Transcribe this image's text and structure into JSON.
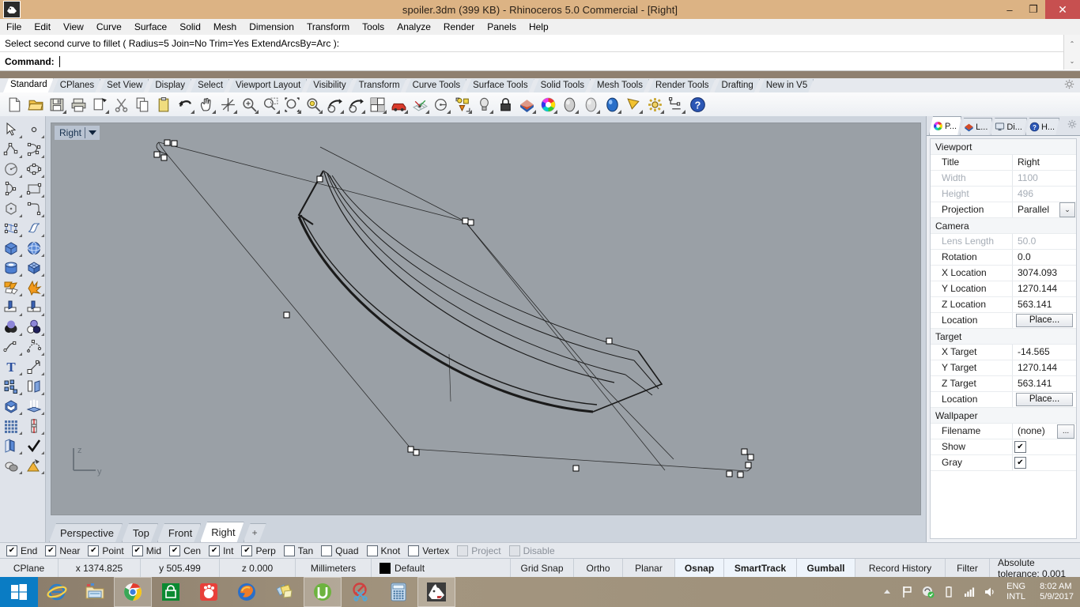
{
  "titlebar": {
    "app_icon": "rhino-icon",
    "title": "spoiler.3dm (399 KB) - Rhinoceros 5.0 Commercial - [Right]",
    "minimize": "–",
    "restore": "❐",
    "close": "✕"
  },
  "menubar": {
    "items": [
      "File",
      "Edit",
      "View",
      "Curve",
      "Surface",
      "Solid",
      "Mesh",
      "Dimension",
      "Transform",
      "Tools",
      "Analyze",
      "Render",
      "Panels",
      "Help"
    ]
  },
  "command": {
    "history": "Select second curve to fillet ( Radius=5  Join=No  Trim=Yes  ExtendArcsBy=Arc ):",
    "prompt_label": "Command:",
    "input_value": "",
    "scroll_up": "⌃",
    "scroll_down": "⌄"
  },
  "toolbar_tabs": {
    "items": [
      "Standard",
      "CPlanes",
      "Set View",
      "Display",
      "Select",
      "Viewport Layout",
      "Visibility",
      "Transform",
      "Curve Tools",
      "Surface Tools",
      "Solid Tools",
      "Mesh Tools",
      "Render Tools",
      "Drafting",
      "New in V5"
    ],
    "active": "Standard",
    "options_icon": "gear-icon"
  },
  "main_toolbar": {
    "icons": [
      "new-file-icon",
      "open-folder-icon",
      "save-icon",
      "print-icon",
      "copy-to-clipboard-icon",
      "cut-icon",
      "copy-icon",
      "paste-icon",
      "undo-icon",
      "pan-icon",
      "move-icon",
      "zoom-in-icon",
      "zoom-dynamic-icon",
      "zoom-window-icon",
      "zoom-extents-icon",
      "zoom-selected-icon",
      "rotate-view-icon",
      "four-viewport-icon",
      "render-icon",
      "grid-snap-icon",
      "circle-center-icon",
      "object-properties-icon",
      "light-icon",
      "lock-icon",
      "layer-icon",
      "color-wheel-icon",
      "shaded-sphere-icon",
      "ghosted-sphere-icon",
      "rendered-sphere-icon",
      "clipping-plane-icon",
      "options-gear-icon",
      "dimension-icon",
      "help-icon"
    ]
  },
  "left_palette": {
    "icons": [
      [
        "select-arrow-icon",
        "point-icon"
      ],
      [
        "polyline-icon",
        "curve-control-points-icon"
      ],
      [
        "circle-icon",
        "ellipse-icon"
      ],
      [
        "arc-icon",
        "rectangle-icon"
      ],
      [
        "polygon-icon",
        "curve-fillet-icon"
      ],
      [
        "surface-control-points-icon",
        "surface-sweep-icon"
      ],
      [
        "box-icon",
        "sphere-icon"
      ],
      [
        "cylinder-icon",
        "mesh-icon"
      ],
      [
        "boolean-union-icon",
        "explode-icon"
      ],
      [
        "trim-icon",
        "split-icon"
      ],
      [
        "boolean-difference-icon",
        "boolean-intersection-icon"
      ],
      [
        "blend-curve-icon",
        "dimension-arc-icon"
      ],
      [
        "text-icon",
        "scale-icon"
      ],
      [
        "array-icon",
        "mirror-icon"
      ],
      [
        "cap-icon",
        "extrude-icon"
      ],
      [
        "grid-array-icon",
        "section-icon"
      ],
      [
        "unroll-icon",
        "check-icon"
      ],
      [
        "shadow-icon",
        "render-paint-icon"
      ]
    ]
  },
  "viewport": {
    "label": "Right",
    "dropdown_icon": "caret-down-icon",
    "axis": {
      "z": "z",
      "y": "y"
    },
    "tabs": [
      {
        "label": "Perspective",
        "active": false
      },
      {
        "label": "Top",
        "active": false
      },
      {
        "label": "Front",
        "active": false
      },
      {
        "label": "Right",
        "active": true
      },
      {
        "label": "+",
        "active": false
      }
    ]
  },
  "right_panel": {
    "tabs": [
      {
        "label": "P...",
        "icon": "properties-color-wheel-icon",
        "active": true
      },
      {
        "label": "L...",
        "icon": "layers-icon",
        "active": false
      },
      {
        "label": "Di...",
        "icon": "display-monitor-icon",
        "active": false
      },
      {
        "label": "H...",
        "icon": "help-icon",
        "active": false
      }
    ],
    "options_icon": "gear-icon",
    "groups": [
      {
        "name": "Viewport",
        "rows": [
          {
            "name": "Title",
            "value": "Right",
            "type": "text",
            "dim": false
          },
          {
            "name": "Width",
            "value": "1100",
            "type": "text",
            "dim": true
          },
          {
            "name": "Height",
            "value": "496",
            "type": "text",
            "dim": true
          },
          {
            "name": "Projection",
            "value": "Parallel",
            "type": "dropdown",
            "dim": false
          }
        ]
      },
      {
        "name": "Camera",
        "rows": [
          {
            "name": "Lens Length",
            "value": "50.0",
            "type": "text",
            "dim": true
          },
          {
            "name": "Rotation",
            "value": "0.0",
            "type": "text",
            "dim": false
          },
          {
            "name": "X Location",
            "value": "3074.093",
            "type": "text",
            "dim": false
          },
          {
            "name": "Y Location",
            "value": "1270.144",
            "type": "text",
            "dim": false
          },
          {
            "name": "Z Location",
            "value": "563.141",
            "type": "text",
            "dim": false
          },
          {
            "name": "Location",
            "value": "Place...",
            "type": "button",
            "dim": false
          }
        ]
      },
      {
        "name": "Target",
        "rows": [
          {
            "name": "X Target",
            "value": "-14.565",
            "type": "text",
            "dim": false
          },
          {
            "name": "Y Target",
            "value": "1270.144",
            "type": "text",
            "dim": false
          },
          {
            "name": "Z Target",
            "value": "563.141",
            "type": "text",
            "dim": false
          },
          {
            "name": "Location",
            "value": "Place...",
            "type": "button",
            "dim": false
          }
        ]
      },
      {
        "name": "Wallpaper",
        "rows": [
          {
            "name": "Filename",
            "value": "(none)",
            "type": "ellipsis",
            "dim": false
          },
          {
            "name": "Show",
            "value": "✔",
            "type": "checkbox",
            "dim": false
          },
          {
            "name": "Gray",
            "value": "✔",
            "type": "checkbox",
            "dim": false
          }
        ]
      }
    ]
  },
  "osnap": {
    "items": [
      {
        "label": "End",
        "checked": true,
        "disabled": false
      },
      {
        "label": "Near",
        "checked": true,
        "disabled": false
      },
      {
        "label": "Point",
        "checked": true,
        "disabled": false
      },
      {
        "label": "Mid",
        "checked": true,
        "disabled": false
      },
      {
        "label": "Cen",
        "checked": true,
        "disabled": false
      },
      {
        "label": "Int",
        "checked": true,
        "disabled": false
      },
      {
        "label": "Perp",
        "checked": true,
        "disabled": false
      },
      {
        "label": "Tan",
        "checked": false,
        "disabled": false
      },
      {
        "label": "Quad",
        "checked": false,
        "disabled": false
      },
      {
        "label": "Knot",
        "checked": false,
        "disabled": false
      },
      {
        "label": "Vertex",
        "checked": false,
        "disabled": false
      },
      {
        "label": "Project",
        "checked": false,
        "disabled": true
      },
      {
        "label": "Disable",
        "checked": false,
        "disabled": true
      }
    ],
    "check_glyph": "✔"
  },
  "statusbar": {
    "cplane": "CPlane",
    "x": "x 1374.825",
    "y": "y 505.499",
    "z": "z 0.000",
    "units": "Millimeters",
    "layer": "Default",
    "layer_color": "#000000",
    "toggles": [
      {
        "label": "Grid Snap",
        "on": false
      },
      {
        "label": "Ortho",
        "on": false
      },
      {
        "label": "Planar",
        "on": false
      },
      {
        "label": "Osnap",
        "on": true
      },
      {
        "label": "SmartTrack",
        "on": true
      },
      {
        "label": "Gumball",
        "on": true
      },
      {
        "label": "Record History",
        "on": false
      },
      {
        "label": "Filter",
        "on": false
      }
    ],
    "tolerance": "Absolute tolerance: 0.001"
  },
  "taskbar": {
    "start": "windows-logo-icon",
    "items": [
      {
        "name": "internet-explorer-icon",
        "active": false
      },
      {
        "name": "file-explorer-icon",
        "active": false
      },
      {
        "name": "google-chrome-icon",
        "active": true
      },
      {
        "name": "windows-store-icon",
        "active": false
      },
      {
        "name": "gom-player-icon",
        "active": false
      },
      {
        "name": "firefox-icon",
        "active": false
      },
      {
        "name": "sticky-notes-icon",
        "active": false
      },
      {
        "name": "utorrent-icon",
        "active": true
      },
      {
        "name": "snipping-tool-icon",
        "active": false
      },
      {
        "name": "calculator-icon",
        "active": false
      },
      {
        "name": "rhinoceros-icon",
        "active": true
      }
    ],
    "tray": [
      "show-hidden-icons-arrow",
      "flag-action-center-icon",
      "nvidia-icon",
      "battery-icon",
      "network-icon",
      "volume-icon"
    ],
    "clock": {
      "lang1": "ENG",
      "lang2": "INTL",
      "time": "8:02 AM",
      "date": "5/9/2017"
    }
  }
}
